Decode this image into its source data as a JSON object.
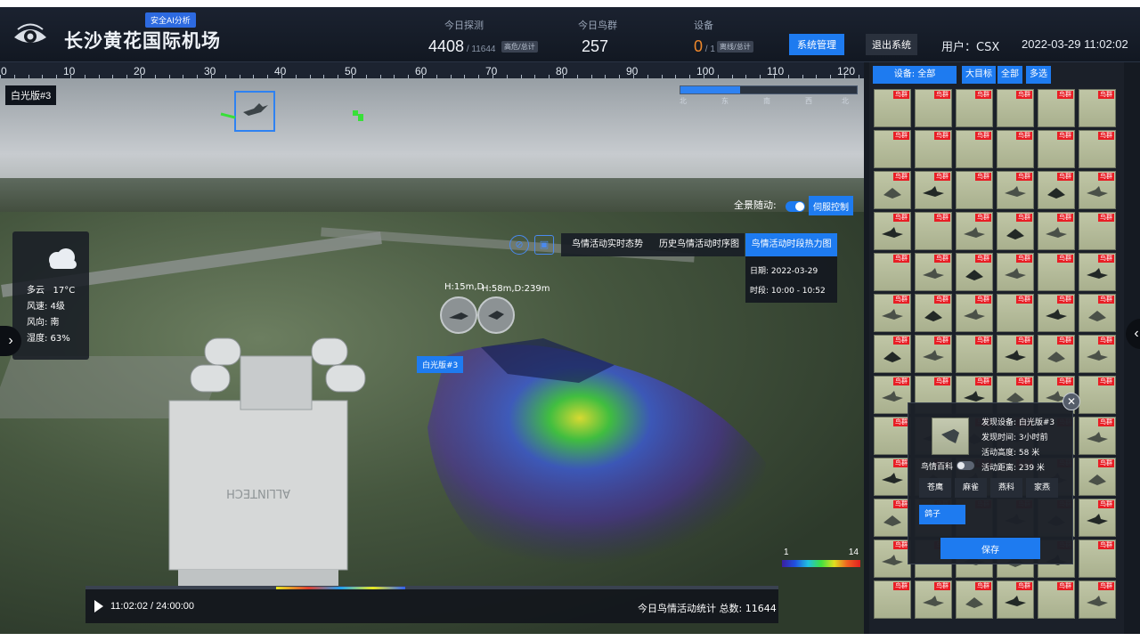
{
  "header": {
    "title": "长沙黄花国际机场",
    "badge": "安全AI分析",
    "stats": {
      "detect_label": "今日探测",
      "detect_value": "4408",
      "detect_total": " / 11644",
      "detect_tag": "高危/总计",
      "flock_label": "今日鸟群",
      "flock_value": "257",
      "device_label": "设备",
      "device_value": "0",
      "device_total": " / 1",
      "device_tag": "离线/总计"
    },
    "system_button": "系统管理",
    "logout_button": "退出系统",
    "user": "用户：CSX",
    "datetime": "2022-03-29 11:02:02"
  },
  "view": {
    "ruler_labels": [
      "0",
      "10",
      "20",
      "30",
      "40",
      "50",
      "60",
      "70",
      "80",
      "90",
      "100",
      "110",
      "120"
    ],
    "camera_tag": "白光版#3",
    "compass_dirs": [
      "北",
      "东",
      "南",
      "西",
      "北"
    ],
    "compass_fill": 0.34,
    "panorama_follow_label": "全景随动:",
    "servo_button": "伺服控制",
    "weather": {
      "condition": "多云",
      "temp": "17°C",
      "wind_speed": "风速:   4级",
      "wind_dir": "风向:   南",
      "humidity": "湿度:   63%"
    },
    "tabs": [
      "鸟情活动实时态势",
      "历史鸟情活动时序图",
      "鸟情活动时段热力图"
    ],
    "active_tab": 2,
    "info": {
      "date": "日期:   2022-03-29",
      "period": "时段:   10:00 - 10:52"
    },
    "bubble_labels": [
      "H:15m,D",
      "H:58m,D:239m"
    ],
    "location_tag": "白光版#3",
    "legend": {
      "min": "1",
      "max": "14"
    },
    "playback": {
      "time": "11:02:02 / 24:00:00",
      "stats": "今日鸟情活动统计 总数:  11644"
    }
  },
  "panel": {
    "filters": [
      "设备:        全部",
      "大目标",
      "全部",
      "多选"
    ],
    "thumb_class": "鸟群",
    "detail": {
      "device": "发现设备:   白光版#3",
      "time": "发现时间:   3小时前",
      "height": "活动高度:   58 米",
      "distance": "活动距离:   239 米",
      "wiki_label": "鸟情百科",
      "species": [
        "苍鹰",
        "麻雀",
        "燕科",
        "家燕"
      ],
      "species_selected": "鸽子",
      "save_button": "保存",
      "close_icon": "✕"
    }
  },
  "colors": {
    "accent": "#1e7bf0",
    "alert": "#e81e25",
    "warning": "#f0882a"
  }
}
